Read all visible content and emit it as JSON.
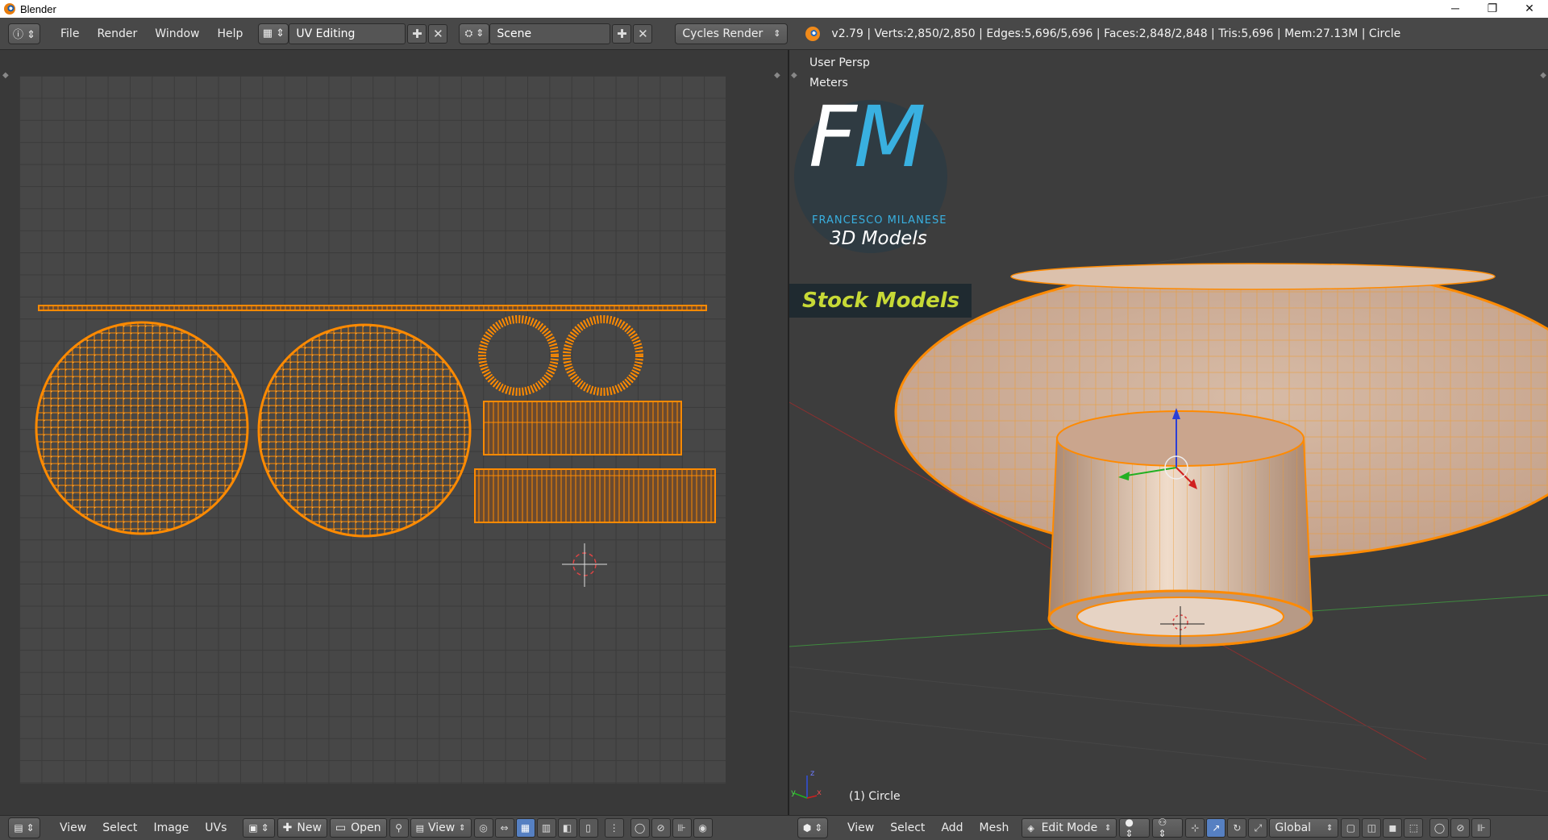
{
  "window": {
    "title": "Blender",
    "controls": [
      "─",
      "❐",
      "✕"
    ]
  },
  "info_header": {
    "menus": [
      "File",
      "Render",
      "Window",
      "Help"
    ],
    "layout": "UV Editing",
    "scene": "Scene",
    "engine": "Cycles Render",
    "stats": "v2.79 | Verts:2,850/2,850 | Edges:5,696/5,696 | Faces:2,848/2,848 | Tris:5,696 | Mem:27.13M | Circle"
  },
  "viewport": {
    "view_name": "User Persp",
    "units": "Meters",
    "object_label": "(1) Circle"
  },
  "logo": {
    "letter_f": "F",
    "letter_m": "M",
    "name": "FRANCESCO MILANESE",
    "tagline": "3D Models",
    "banner": "Stock Models"
  },
  "uv_header": {
    "menus": [
      "View",
      "Select",
      "Image",
      "UVs"
    ],
    "new_label": "New",
    "open_label": "Open",
    "view_label": "View"
  },
  "view3d_header": {
    "menus": [
      "View",
      "Select",
      "Add",
      "Mesh"
    ],
    "mode": "Edit Mode",
    "orientation": "Global"
  },
  "colors": {
    "uv_wire": "#ff8a00",
    "selection": "#f3a23a",
    "mesh_face": "#c9a58c"
  }
}
